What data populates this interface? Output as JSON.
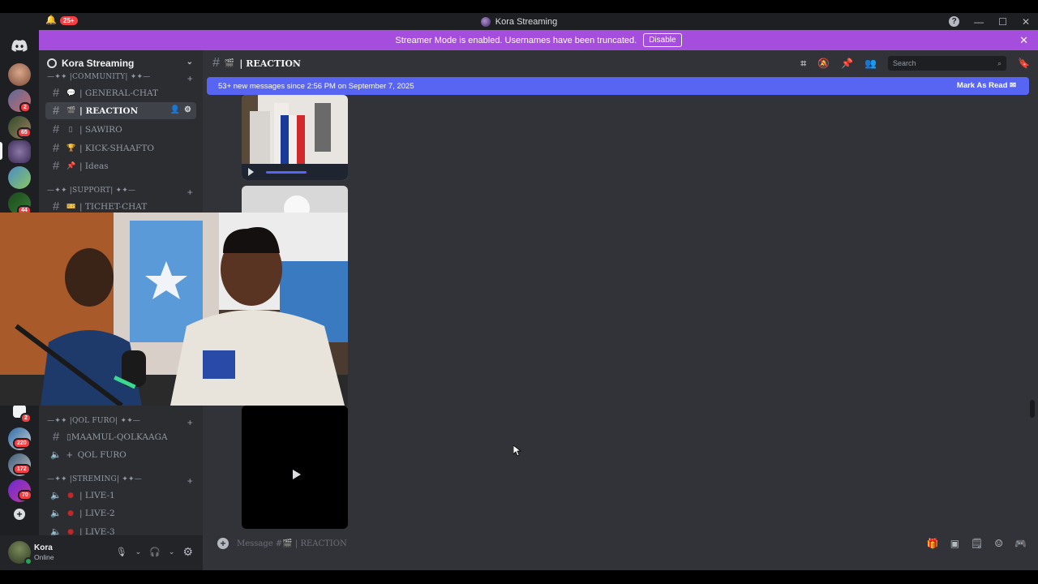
{
  "titlebar": {
    "title": "Kora Streaming",
    "notifications_badge": "25+"
  },
  "banner": {
    "text": "Streamer Mode is enabled. Usernames have been truncated.",
    "button": "Disable"
  },
  "rail": {
    "badges": [
      "2",
      "65",
      "44",
      "2",
      "220",
      "172",
      "70"
    ]
  },
  "server": {
    "name": "Kora Streaming"
  },
  "categories": {
    "community": "—✦✦ |COMMUNITY| ✦✦—",
    "support": "—✦✦ |SUPPORT| ✦✦—",
    "qol_furo": "—✦✦ |QOL FURO| ✦✦—",
    "streming": "—✦✦ |STREMING| ✦✦—"
  },
  "channels": [
    {
      "label": "| GENERAL-CHAT",
      "icon": "💬"
    },
    {
      "label": "| REACTION",
      "icon": "🎬"
    },
    {
      "label": "| SAWIRO",
      "icon": "▯"
    },
    {
      "label": "| KICK-SHAAFTO",
      "icon": "🏆"
    },
    {
      "label": "| Ideas",
      "icon": "📌"
    },
    {
      "label": "| TICHET-CHAT",
      "icon": "🎫"
    },
    {
      "label": "▯MAAMUL-QOLKAAGA",
      "icon": ""
    },
    {
      "label": "QOL FURO",
      "icon": "+"
    },
    {
      "label": "| LIVE-1",
      "icon": "●"
    },
    {
      "label": "| LIVE-2",
      "icon": "●"
    },
    {
      "label": "| LIVE-3",
      "icon": "●"
    }
  ],
  "user": {
    "name": "Kora",
    "status": "Online"
  },
  "header": {
    "channel": "| REACTION",
    "search_placeholder": "Search"
  },
  "new_messages": {
    "text": "53+ new messages since 2:56 PM on September 7, 2025",
    "action": "Mark As Read"
  },
  "composer": {
    "placeholder": "Message #🎬 | REACTION"
  },
  "colors": {
    "banner": "#a54ddc",
    "blurple": "#5865f2",
    "online": "#23a55a",
    "badge": "#f23f43"
  }
}
